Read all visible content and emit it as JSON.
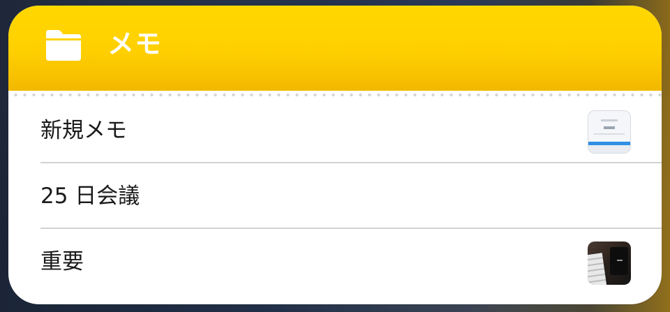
{
  "widget": {
    "title": "メモ",
    "header_icon": "folder-icon",
    "accent_color": "#FFD000"
  },
  "notes": [
    {
      "title": "新規メモ",
      "thumbnail": "document-thumbnail"
    },
    {
      "title": "25 日会議",
      "thumbnail": null
    },
    {
      "title": "重要",
      "thumbnail": "photo-thumbnail"
    }
  ]
}
